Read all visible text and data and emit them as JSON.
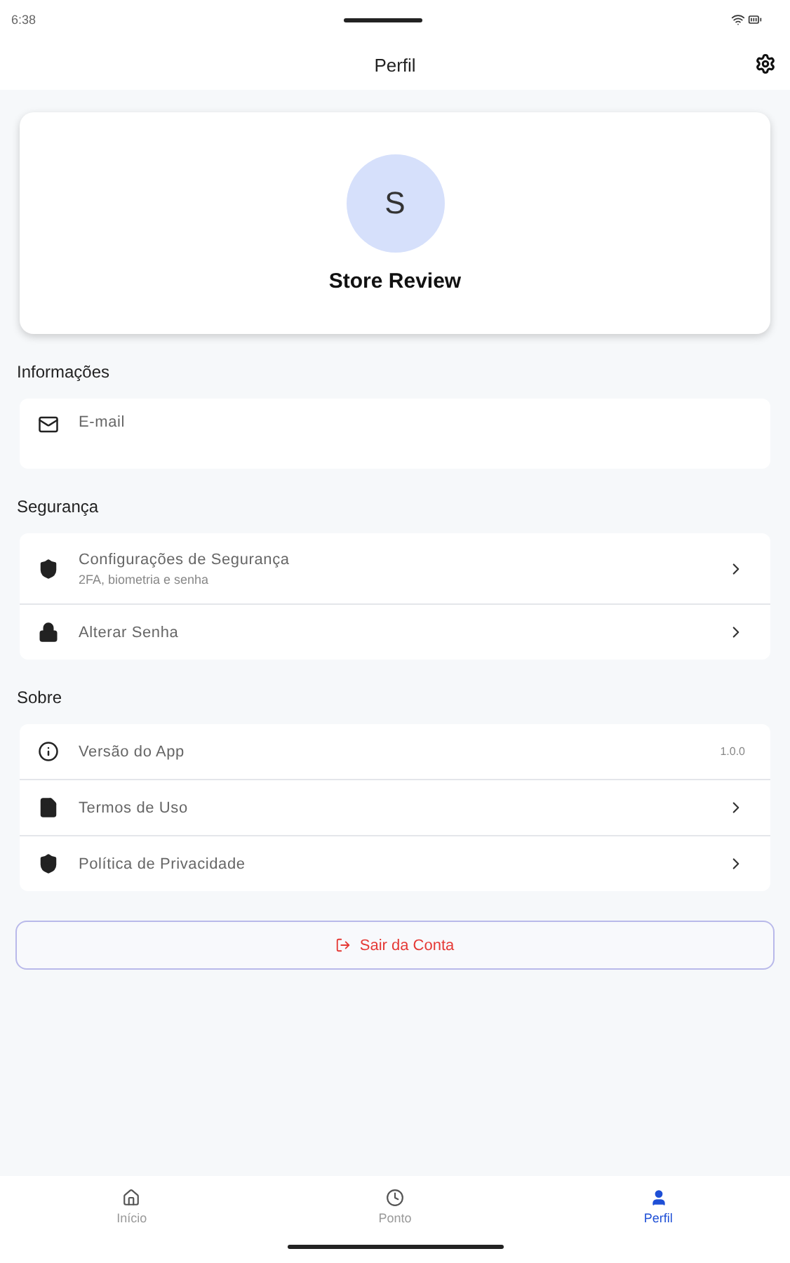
{
  "status_bar": {
    "time": "6:38"
  },
  "header": {
    "title": "Perfil"
  },
  "profile": {
    "initial": "S",
    "name": "Store Review"
  },
  "sections": [
    {
      "title": "Informações",
      "items": [
        {
          "kind": "info",
          "label": "E-mail"
        }
      ]
    },
    {
      "title": "Segurança",
      "items": [
        {
          "kind": "nav",
          "label": "Configurações de Segurança",
          "subtitle": "2FA, biometria e senha"
        },
        {
          "kind": "nav",
          "label": "Alterar Senha"
        }
      ]
    },
    {
      "title": "Sobre",
      "items": [
        {
          "kind": "value",
          "label": "Versão do App",
          "value": "1.0.0"
        },
        {
          "kind": "nav",
          "label": "Termos de Uso"
        },
        {
          "kind": "nav",
          "label": "Política de Privacidade"
        }
      ]
    }
  ],
  "logout": {
    "label": "Sair da Conta"
  },
  "nav": [
    {
      "label": "Início",
      "selected": false
    },
    {
      "label": "Ponto",
      "selected": false
    },
    {
      "label": "Perfil",
      "selected": true
    }
  ]
}
